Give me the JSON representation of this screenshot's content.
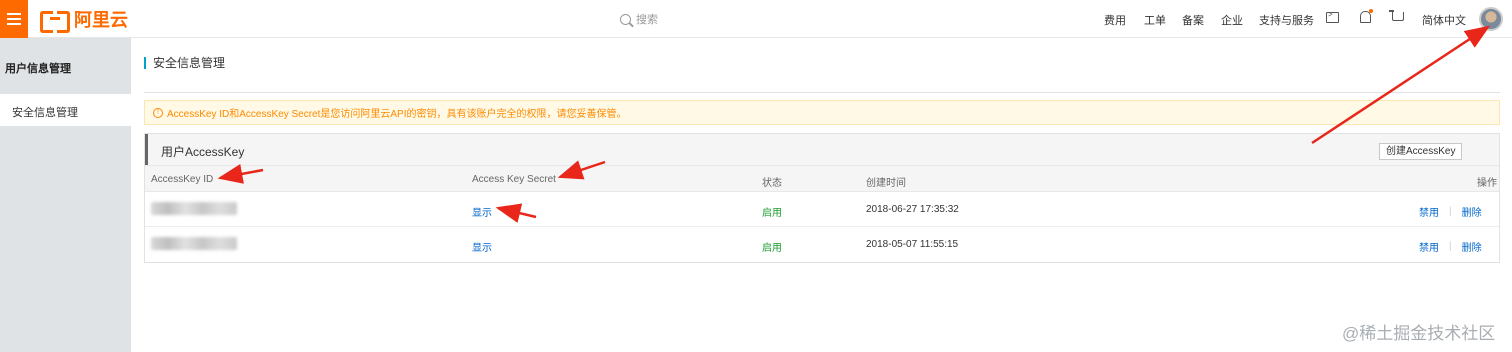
{
  "topbar": {
    "logo_text": "阿里云",
    "search_placeholder": "搜索",
    "nav": [
      "费用",
      "工单",
      "备案",
      "企业",
      "支持与服务"
    ],
    "language": "简体中文",
    "brand_color": "#ff6a00"
  },
  "sidebar": {
    "title": "用户信息管理",
    "items": [
      {
        "label": "安全信息管理",
        "active": true
      }
    ]
  },
  "main": {
    "page_title": "安全信息管理",
    "alert": "AccessKey ID和AccessKey Secret是您访问阿里云API的密钥，具有该账户完全的权限，请您妥善保管。",
    "panel_title": "用户AccessKey",
    "create_button": "创建AccessKey",
    "columns": [
      "AccessKey ID",
      "Access Key Secret",
      "状态",
      "创建时间",
      "操作"
    ],
    "rows": [
      {
        "secret": "显示",
        "status": "启用",
        "created": "2018-06-27 17:35:32",
        "disable": "禁用",
        "delete": "删除"
      },
      {
        "secret": "显示",
        "status": "启用",
        "created": "2018-05-07 11:55:15",
        "disable": "禁用",
        "delete": "删除"
      }
    ]
  },
  "watermark": "@稀土掘金技术社区",
  "colors": {
    "link": "#0066cc",
    "status_ok": "#1e9e31",
    "alert_text": "#ff8a00",
    "arrow": "#e8261a"
  }
}
